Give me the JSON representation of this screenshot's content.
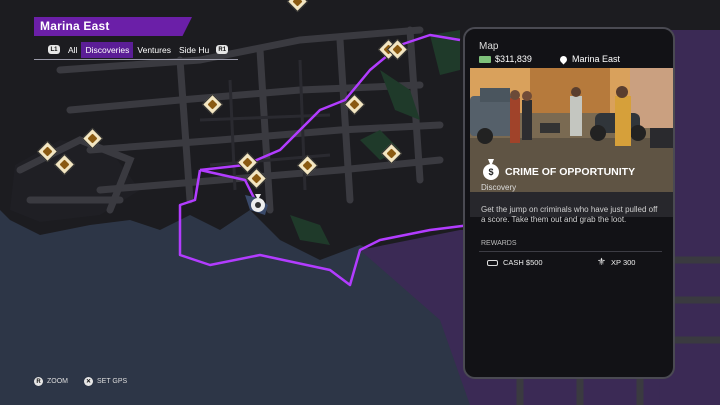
{
  "header": {
    "region_name": "Marina East",
    "filters": {
      "left_button": "L1",
      "right_button": "R1",
      "items": [
        "All",
        "Discoveries",
        "Ventures",
        "Side Hu"
      ],
      "active_index": 1
    }
  },
  "card": {
    "title": "Map",
    "money": "$311,839",
    "location": "Marina East",
    "mission_title": "CRIME OF OPPORTUNITY",
    "category": "Discovery",
    "description": "Get the jump on criminals who have just pulled off a score. Take them out and grab the loot.",
    "rewards_label": "REWARDS",
    "rewards": {
      "cash": "CASH $500",
      "xp": "XP 300"
    }
  },
  "hints": {
    "zoom": "ZOOM",
    "set_gps": "SET GPS"
  },
  "icons": {
    "money": "cash-stack-icon",
    "location": "location-pin-icon",
    "mission": "money-bag-icon",
    "cash_reward": "cash-icon",
    "xp_reward": "fleur-de-lis-icon"
  },
  "colors": {
    "accent_purple": "#6b1fa8",
    "route_purple": "#b23cff",
    "marker_fill": "#f3e6c2",
    "water": "#2d3647",
    "land": "#1b1b1f",
    "roads": "#3a3a40"
  }
}
